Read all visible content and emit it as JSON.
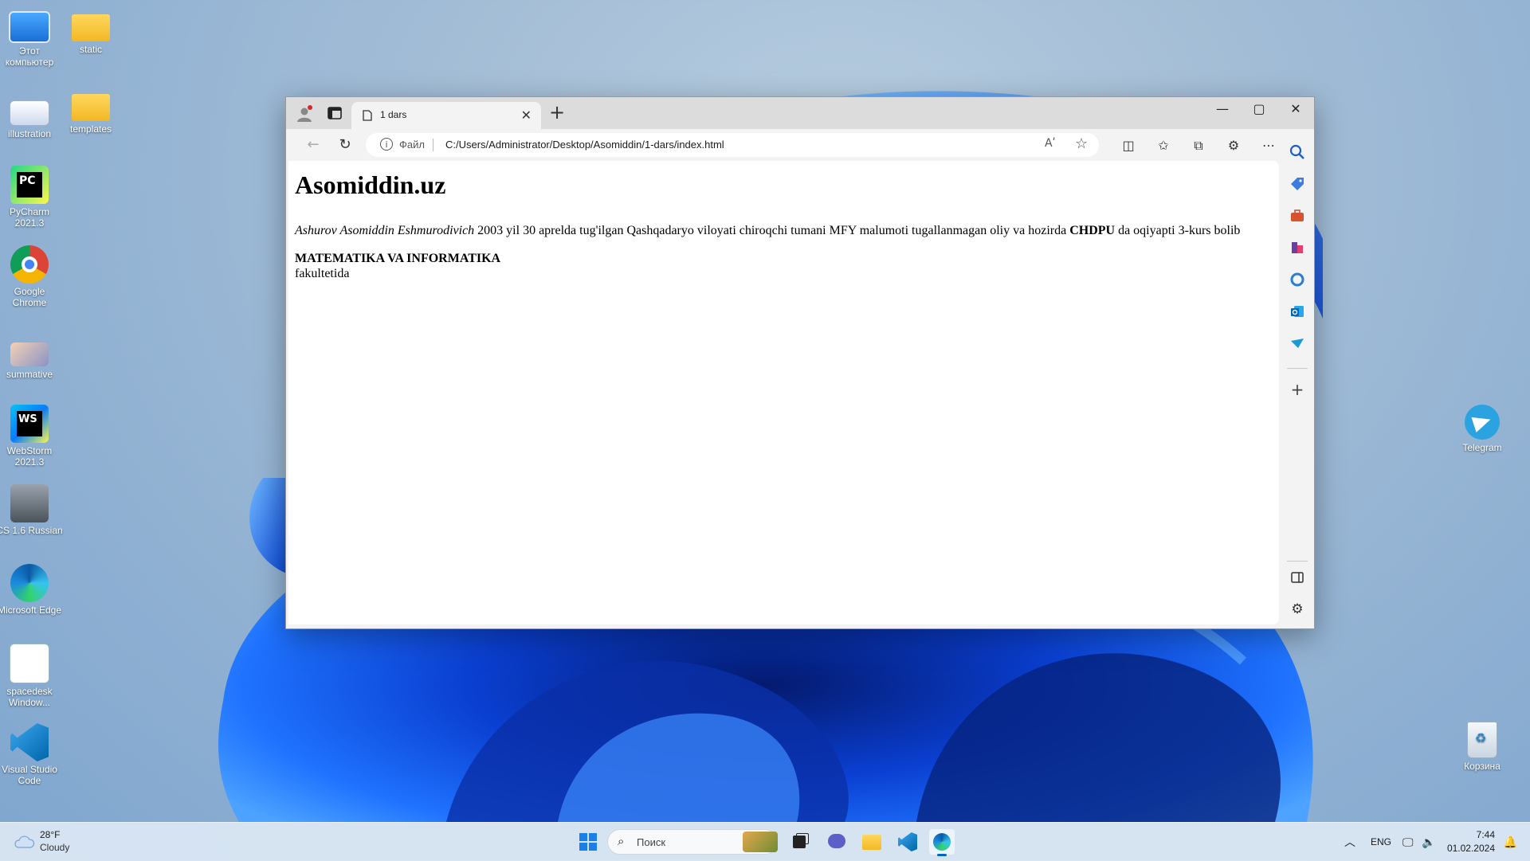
{
  "desktop": {
    "icons_left": [
      {
        "label": "Этот компьютер",
        "icon": "computer-icon"
      },
      {
        "label": "illustration",
        "icon": "image-file-icon"
      },
      {
        "label": "PyCharm 2021.3",
        "icon": "pycharm-icon"
      },
      {
        "label": "Google Chrome",
        "icon": "chrome-icon"
      },
      {
        "label": "summative",
        "icon": "image-file-icon"
      },
      {
        "label": "WebStorm 2021.3",
        "icon": "webstorm-icon"
      },
      {
        "label": "CS 1.6 Russian",
        "icon": "cs-icon"
      },
      {
        "label": "Microsoft Edge",
        "icon": "edge-icon"
      },
      {
        "label": "spacedesk Window...",
        "icon": "spacedesk-icon"
      },
      {
        "label": "Visual Studio Code",
        "icon": "vscode-icon"
      }
    ],
    "icons_col2": [
      {
        "label": "static",
        "icon": "folder-icon"
      },
      {
        "label": "templates",
        "icon": "folder-icon"
      }
    ],
    "icons_right": [
      {
        "label": "Telegram",
        "icon": "telegram-icon"
      },
      {
        "label": "Корзина",
        "icon": "recycle-bin-icon"
      }
    ]
  },
  "browser": {
    "tab_title": "1 dars",
    "address_scheme": "Файл",
    "address_url": "C:/Users/Administrator/Desktop/Asomiddin/1-dars/index.html",
    "readaloud_glyph": "Aʹ",
    "page": {
      "heading": "Asomiddin.uz",
      "para_italic": "Ashurov Asomiddin Eshmurodivich",
      "para_mid": " 2003 yil 30 aprelda tug'ilgan Qashqadaryo viloyati chiroqchi tumani MFY malumoti tugallanmagan oliy va hozirda ",
      "para_bold": "CHDPU",
      "para_end": " da oqiyapti 3-kurs bolib",
      "faculty_bold": "MATEMATIKA VA INFORMATIKA",
      "faculty_tail": "fakultetida"
    }
  },
  "taskbar": {
    "weather_temp": "28°F",
    "weather_condition": "Cloudy",
    "search_placeholder": "Поиск",
    "language": "ENG",
    "time": "7:44",
    "date": "01.02.2024"
  },
  "colors": {
    "accent": "#0067c0",
    "wallpaper_blue": "#1a5cf0"
  }
}
